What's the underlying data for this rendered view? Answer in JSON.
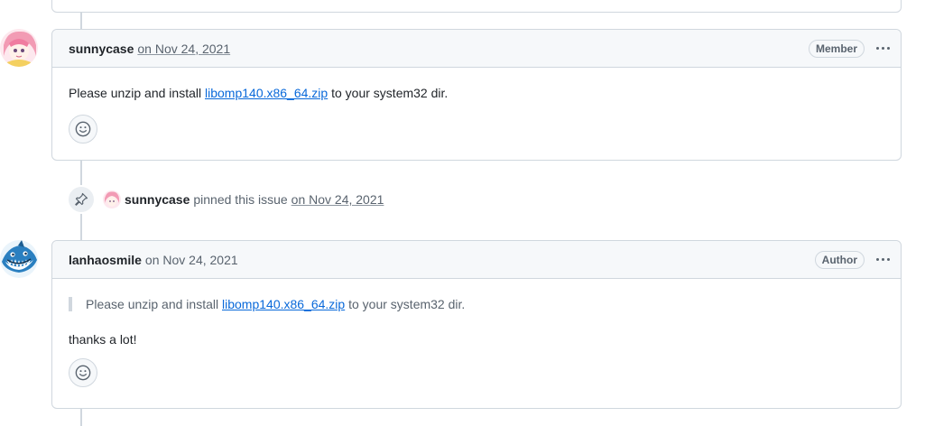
{
  "comments": [
    {
      "author": "sunnycase",
      "date": "on Nov 24, 2021",
      "badge": "Member",
      "body_prefix": "Please unzip and install ",
      "link_text": "libomp140.x86_64.zip",
      "body_suffix": " to your system32 dir."
    },
    {
      "author": "lanhaosmile",
      "date": "on Nov 24, 2021",
      "badge": "Author",
      "quote_prefix": "Please unzip and install ",
      "quote_link": "libomp140.x86_64.zip",
      "quote_suffix": " to your system32 dir.",
      "body": "thanks a lot!"
    }
  ],
  "event": {
    "author": "sunnycase",
    "text": "pinned this issue",
    "date": "on Nov 24, 2021",
    "icon": "pin-icon"
  },
  "icons": {
    "reaction": "smiley-icon",
    "menu": "kebab-horizontal-icon"
  },
  "colors": {
    "link": "#0969da",
    "border": "#d0d7de",
    "header_bg": "#f6f8fa",
    "muted": "#59636e"
  }
}
